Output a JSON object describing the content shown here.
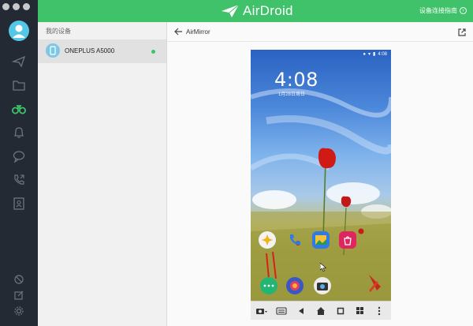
{
  "app": {
    "brand": "AirDroid",
    "guide_link": "设备连接指南",
    "accent": "#3fc26a"
  },
  "sidebar": {
    "icons": [
      "send-icon",
      "folder-icon",
      "binoculars-icon",
      "bell-icon",
      "chat-icon",
      "call-icon",
      "contacts-icon",
      "block-icon",
      "edit-icon",
      "settings-icon"
    ]
  },
  "devices": {
    "title": "我的设备",
    "items": [
      {
        "name": "ONEPLUS A5000",
        "status": "online"
      }
    ]
  },
  "main": {
    "title": "AirMirror"
  },
  "phone": {
    "status_time": "4:08",
    "lock_time": "4:08",
    "date": "1月28日周日",
    "apps": [
      {
        "label": ""
      },
      {
        "label": ""
      },
      {
        "label": ""
      },
      {
        "label": ""
      }
    ],
    "dock_labels": [
      "",
      "",
      "",
      ""
    ]
  }
}
